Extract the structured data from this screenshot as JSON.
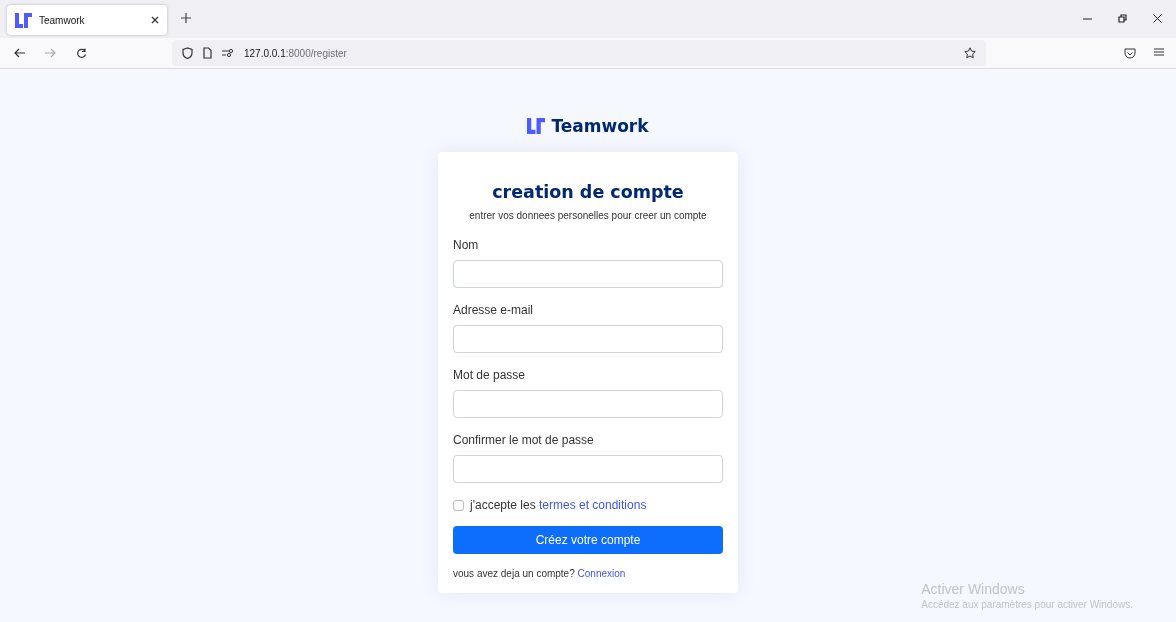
{
  "browser": {
    "tab": {
      "title": "Teamwork",
      "selected": true
    },
    "url_host": "127.0.0.1",
    "url_path": ":8000/register"
  },
  "brand": "Teamwork",
  "card": {
    "title": "creation de compte",
    "subtitle": "entrer vos donnees personelles pour creer un compte",
    "fields": [
      {
        "label": "Nom"
      },
      {
        "label": "Adresse e-mail"
      },
      {
        "label": "Mot de passe"
      },
      {
        "label": "Confirmer le mot de passe"
      }
    ],
    "terms": {
      "checked": false,
      "text": "j'accepte les ",
      "link": "termes et conditions"
    },
    "submit": "Créez votre compte",
    "footer": {
      "text": "vous avez deja un compte? ",
      "link": "Connexion"
    }
  },
  "os_notice": {
    "title": "Activer Windows",
    "text": "Accédez aux paramètres pour activer Windows."
  }
}
